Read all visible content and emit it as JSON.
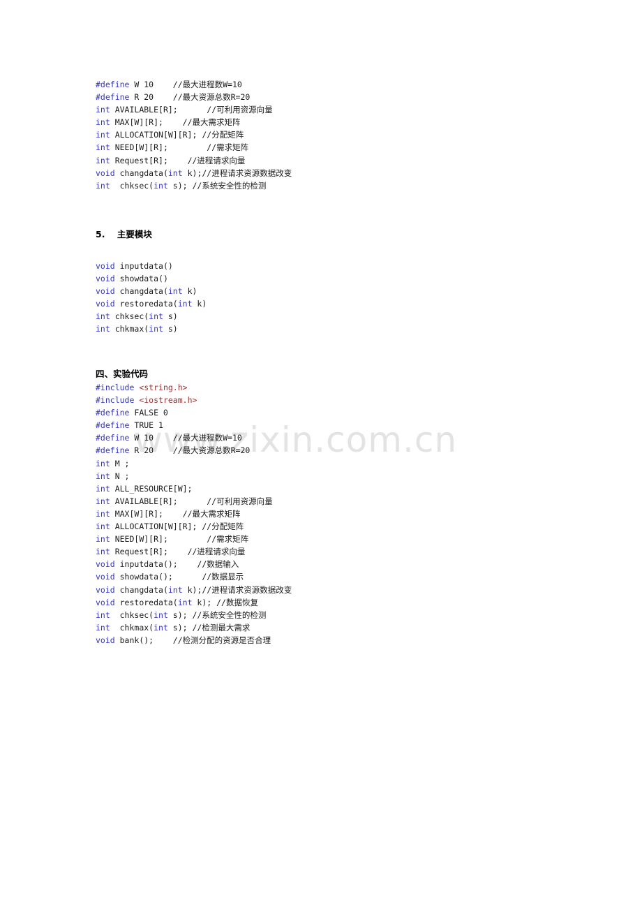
{
  "watermark": {
    "text": "www.zixin.com.cn"
  },
  "sections": {
    "declarations": {
      "lines": [
        {
          "parts": [
            {
              "t": "#define",
              "c": "kw"
            },
            {
              "t": " W 10    ",
              "c": "id"
            },
            {
              "t": "//最大进程数W=10",
              "c": "cmt"
            }
          ]
        },
        {
          "parts": [
            {
              "t": "#define",
              "c": "kw"
            },
            {
              "t": " R 20    ",
              "c": "id"
            },
            {
              "t": "//最大资源总数R=20",
              "c": "cmt"
            }
          ]
        },
        {
          "parts": [
            {
              "t": "int",
              "c": "kw"
            },
            {
              "t": " AVAILABLE[R];      ",
              "c": "id"
            },
            {
              "t": "//可利用资源向量",
              "c": "cmt"
            }
          ]
        },
        {
          "parts": [
            {
              "t": "int",
              "c": "kw"
            },
            {
              "t": " MAX[W][R];    ",
              "c": "id"
            },
            {
              "t": "//最大需求矩阵",
              "c": "cmt"
            }
          ]
        },
        {
          "parts": [
            {
              "t": "int",
              "c": "kw"
            },
            {
              "t": " ALLOCATION[W][R]; ",
              "c": "id"
            },
            {
              "t": "//分配矩阵",
              "c": "cmt"
            }
          ]
        },
        {
          "parts": [
            {
              "t": "int",
              "c": "kw"
            },
            {
              "t": " NEED[W][R];        ",
              "c": "id"
            },
            {
              "t": "//需求矩阵",
              "c": "cmt"
            }
          ]
        },
        {
          "parts": [
            {
              "t": "int",
              "c": "kw"
            },
            {
              "t": " Request[R];    ",
              "c": "id"
            },
            {
              "t": "//进程请求向量",
              "c": "cmt"
            }
          ]
        },
        {
          "parts": [
            {
              "t": "void",
              "c": "kw"
            },
            {
              "t": " changdata(",
              "c": "id"
            },
            {
              "t": "int",
              "c": "kw"
            },
            {
              "t": " k);",
              "c": "id"
            },
            {
              "t": "//进程请求资源数据改变",
              "c": "cmt"
            }
          ]
        },
        {
          "parts": [
            {
              "t": "int",
              "c": "kw"
            },
            {
              "t": "  chksec(",
              "c": "id"
            },
            {
              "t": "int",
              "c": "kw"
            },
            {
              "t": " s); ",
              "c": "id"
            },
            {
              "t": "//系统安全性的检测",
              "c": "cmt"
            }
          ]
        }
      ]
    },
    "modules": {
      "heading_number": "5.",
      "heading_text": "主要模块",
      "lines": [
        {
          "parts": [
            {
              "t": "void",
              "c": "kw"
            },
            {
              "t": " inputdata()",
              "c": "id"
            }
          ]
        },
        {
          "parts": [
            {
              "t": "void",
              "c": "kw"
            },
            {
              "t": " showdata()",
              "c": "id"
            }
          ]
        },
        {
          "parts": [
            {
              "t": "void",
              "c": "kw"
            },
            {
              "t": " changdata(",
              "c": "id"
            },
            {
              "t": "int",
              "c": "kw"
            },
            {
              "t": " k)",
              "c": "id"
            }
          ]
        },
        {
          "parts": [
            {
              "t": "void",
              "c": "kw"
            },
            {
              "t": " restoredata(",
              "c": "id"
            },
            {
              "t": "int",
              "c": "kw"
            },
            {
              "t": " k)",
              "c": "id"
            }
          ]
        },
        {
          "parts": [
            {
              "t": "int",
              "c": "kw"
            },
            {
              "t": " chksec(",
              "c": "id"
            },
            {
              "t": "int",
              "c": "kw"
            },
            {
              "t": " s)",
              "c": "id"
            }
          ]
        },
        {
          "parts": [
            {
              "t": "int",
              "c": "kw"
            },
            {
              "t": " chkmax(",
              "c": "id"
            },
            {
              "t": "int",
              "c": "kw"
            },
            {
              "t": " s)",
              "c": "id"
            }
          ]
        }
      ]
    },
    "experiment_code": {
      "heading_text": "四、实验代码",
      "lines": [
        {
          "parts": [
            {
              "t": "#include",
              "c": "inc"
            },
            {
              "t": " ",
              "c": "id"
            },
            {
              "t": "<string.h>",
              "c": "hdr"
            }
          ]
        },
        {
          "parts": [
            {
              "t": "#include",
              "c": "inc"
            },
            {
              "t": " ",
              "c": "id"
            },
            {
              "t": "<iostream.h>",
              "c": "hdr"
            }
          ]
        },
        {
          "parts": [
            {
              "t": "#define",
              "c": "kw"
            },
            {
              "t": " FALSE 0",
              "c": "id"
            }
          ]
        },
        {
          "parts": [
            {
              "t": "#define",
              "c": "kw"
            },
            {
              "t": " TRUE 1",
              "c": "id"
            }
          ]
        },
        {
          "parts": [
            {
              "t": "#define",
              "c": "kw"
            },
            {
              "t": " W 10    ",
              "c": "id"
            },
            {
              "t": "//最大进程数W=10",
              "c": "cmt"
            }
          ]
        },
        {
          "parts": [
            {
              "t": "#define",
              "c": "kw"
            },
            {
              "t": " R 20    ",
              "c": "id"
            },
            {
              "t": "//最大资源总数R=20",
              "c": "cmt"
            }
          ]
        },
        {
          "parts": [
            {
              "t": "int",
              "c": "kw"
            },
            {
              "t": " M ;",
              "c": "id"
            }
          ]
        },
        {
          "parts": [
            {
              "t": "int",
              "c": "kw"
            },
            {
              "t": " N ;",
              "c": "id"
            }
          ]
        },
        {
          "parts": [
            {
              "t": "int",
              "c": "kw"
            },
            {
              "t": " ALL_RESOURCE[W];",
              "c": "id"
            }
          ]
        },
        {
          "parts": [
            {
              "t": "int",
              "c": "kw"
            },
            {
              "t": " AVAILABLE[R];      ",
              "c": "id"
            },
            {
              "t": "//可利用资源向量",
              "c": "cmt"
            }
          ]
        },
        {
          "parts": [
            {
              "t": "int",
              "c": "kw"
            },
            {
              "t": " MAX[W][R];    ",
              "c": "id"
            },
            {
              "t": "//最大需求矩阵",
              "c": "cmt"
            }
          ]
        },
        {
          "parts": [
            {
              "t": "int",
              "c": "kw"
            },
            {
              "t": " ALLOCATION[W][R]; ",
              "c": "id"
            },
            {
              "t": "//分配矩阵",
              "c": "cmt"
            }
          ]
        },
        {
          "parts": [
            {
              "t": "int",
              "c": "kw"
            },
            {
              "t": " NEED[W][R];        ",
              "c": "id"
            },
            {
              "t": "//需求矩阵",
              "c": "cmt"
            }
          ]
        },
        {
          "parts": [
            {
              "t": "int",
              "c": "kw"
            },
            {
              "t": " Request[R];    ",
              "c": "id"
            },
            {
              "t": "//进程请求向量",
              "c": "cmt"
            }
          ]
        },
        {
          "parts": [
            {
              "t": "void",
              "c": "kw"
            },
            {
              "t": " inputdata();    ",
              "c": "id"
            },
            {
              "t": "//数据输入",
              "c": "cmt"
            }
          ]
        },
        {
          "parts": [
            {
              "t": "void",
              "c": "kw"
            },
            {
              "t": " showdata();      ",
              "c": "id"
            },
            {
              "t": "//数据显示",
              "c": "cmt"
            }
          ]
        },
        {
          "parts": [
            {
              "t": "void",
              "c": "kw"
            },
            {
              "t": " changdata(",
              "c": "id"
            },
            {
              "t": "int",
              "c": "kw"
            },
            {
              "t": " k);",
              "c": "id"
            },
            {
              "t": "//进程请求资源数据改变",
              "c": "cmt"
            }
          ]
        },
        {
          "parts": [
            {
              "t": "void",
              "c": "kw"
            },
            {
              "t": " restoredata(",
              "c": "id"
            },
            {
              "t": "int",
              "c": "kw"
            },
            {
              "t": " k); ",
              "c": "id"
            },
            {
              "t": "//数据恢复",
              "c": "cmt"
            }
          ]
        },
        {
          "parts": [
            {
              "t": "int",
              "c": "kw"
            },
            {
              "t": "  chksec(",
              "c": "id"
            },
            {
              "t": "int",
              "c": "kw"
            },
            {
              "t": " s); ",
              "c": "id"
            },
            {
              "t": "//系统安全性的检测",
              "c": "cmt"
            }
          ]
        },
        {
          "parts": [
            {
              "t": "int",
              "c": "kw"
            },
            {
              "t": "  chkmax(",
              "c": "id"
            },
            {
              "t": "int",
              "c": "kw"
            },
            {
              "t": " s); ",
              "c": "id"
            },
            {
              "t": "//检测最大需求",
              "c": "cmt"
            }
          ]
        },
        {
          "parts": [
            {
              "t": "void",
              "c": "kw"
            },
            {
              "t": " bank();    ",
              "c": "id"
            },
            {
              "t": "//检测分配的资源是否合理",
              "c": "cmt"
            }
          ]
        }
      ]
    }
  },
  "colors": {
    "keyword": "#3333cc",
    "header_literal": "#993333",
    "text": "#1a1a1a",
    "watermark": "#e3e3e3",
    "page_background": "#ffffff"
  }
}
